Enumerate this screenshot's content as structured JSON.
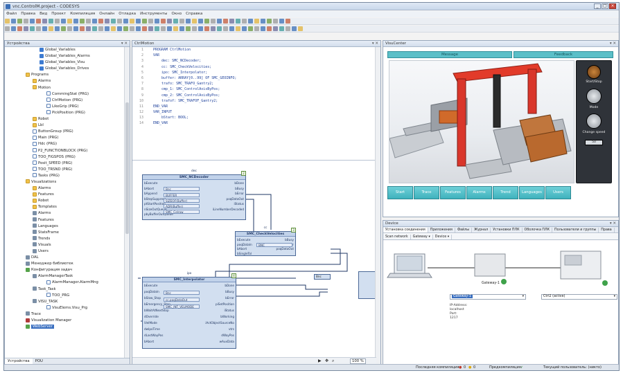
{
  "window": {
    "title": "vnc.ControlM.project - CODESYS",
    "min": "_",
    "max": "□",
    "close": "×"
  },
  "menu": [
    "Файл",
    "Правка",
    "Вид",
    "Проект",
    "Компиляция",
    "Онлайн",
    "Отладка",
    "Инструменты",
    "Окно",
    "Справка"
  ],
  "devices_panel": {
    "title": "Устройства",
    "header_btns": "▾ ✕",
    "tree": [
      {
        "indent": 5,
        "icon": "var",
        "label": "Global_Variables"
      },
      {
        "indent": 5,
        "icon": "var",
        "label": "Global_Variables_Alarms"
      },
      {
        "indent": 5,
        "icon": "var",
        "label": "Global_Variables_Visu"
      },
      {
        "indent": 5,
        "icon": "var",
        "label": "Global_Variables_Drives"
      },
      {
        "indent": 3,
        "icon": "folder",
        "label": "Programs"
      },
      {
        "indent": 4,
        "icon": "folder",
        "label": "Alarms"
      },
      {
        "indent": 4,
        "icon": "folder",
        "label": "Motion"
      },
      {
        "indent": 6,
        "icon": "prg",
        "label": "CommingStat (PRG)"
      },
      {
        "indent": 6,
        "icon": "prg",
        "label": "CtrlMotion (PRG)"
      },
      {
        "indent": 6,
        "icon": "prg",
        "label": "LikeGrip (PRG)"
      },
      {
        "indent": 6,
        "icon": "prg",
        "label": "PickPosition (PRG)"
      },
      {
        "indent": 4,
        "icon": "folder",
        "label": "Robot"
      },
      {
        "indent": 4,
        "icon": "folder",
        "label": "Lbl"
      },
      {
        "indent": 4,
        "icon": "prg",
        "label": "ButtonGroup (PRG)"
      },
      {
        "indent": 4,
        "icon": "prg",
        "label": "Main (PRG)"
      },
      {
        "indent": 4,
        "icon": "prg",
        "label": "Hdc (PRG)"
      },
      {
        "indent": 4,
        "icon": "prg",
        "label": "P2_FUNCTIONBLOCK (PRG)"
      },
      {
        "indent": 4,
        "icon": "prg",
        "label": "TOO_FIGSPOS (PRG)"
      },
      {
        "indent": 4,
        "icon": "prg",
        "label": "Posit_SPEED (PRG)"
      },
      {
        "indent": 4,
        "icon": "prg",
        "label": "TOO_TRSND (PRG)"
      },
      {
        "indent": 4,
        "icon": "prg",
        "label": "Tasks (PRG)"
      },
      {
        "indent": 3,
        "icon": "folder",
        "label": "Visualizations"
      },
      {
        "indent": 4,
        "icon": "folder",
        "label": "Alarms"
      },
      {
        "indent": 4,
        "icon": "folder",
        "label": "Features"
      },
      {
        "indent": 4,
        "icon": "folder",
        "label": "Robot"
      },
      {
        "indent": 4,
        "icon": "folder",
        "label": "Templates"
      },
      {
        "indent": 4,
        "icon": "cfg",
        "label": "Alarms"
      },
      {
        "indent": 4,
        "icon": "cfg",
        "label": "Features"
      },
      {
        "indent": 4,
        "icon": "cfg",
        "label": "Languages"
      },
      {
        "indent": 4,
        "icon": "cfg",
        "label": "StatsFrame"
      },
      {
        "indent": 4,
        "icon": "cfg",
        "label": "Trends"
      },
      {
        "indent": 4,
        "icon": "cfg",
        "label": "Visuals"
      },
      {
        "indent": 4,
        "icon": "cfg",
        "label": "Users"
      },
      {
        "indent": 3,
        "icon": "cfg",
        "label": "DAL"
      },
      {
        "indent": 3,
        "icon": "cfg",
        "label": "Менеджер библиотек"
      },
      {
        "indent": 3,
        "icon": "green",
        "label": "Конфигурация задач"
      },
      {
        "indent": 4,
        "icon": "cfg",
        "label": "AlarmManagerTask"
      },
      {
        "indent": 6,
        "icon": "prg",
        "label": "AlarmManager.AlarmMng"
      },
      {
        "indent": 4,
        "icon": "cfg",
        "label": "Task_Task"
      },
      {
        "indent": 6,
        "icon": "prg",
        "label": "TOO_PRG"
      },
      {
        "indent": 4,
        "icon": "cfg",
        "label": "VISU_TASK"
      },
      {
        "indent": 6,
        "icon": "prg",
        "label": "VisuElems.Visu_Prg"
      },
      {
        "indent": 3,
        "icon": "cfg",
        "label": "Trace"
      },
      {
        "indent": 3,
        "icon": "app",
        "label": "Visualization Manager"
      },
      {
        "indent": 3,
        "icon": "green",
        "label": "WebServer",
        "selected": true
      }
    ],
    "bottom_tabs": [
      "Устройства",
      "POU"
    ]
  },
  "editor": {
    "title": "CtrlMotion",
    "code": [
      {
        "ln": "1",
        "text": "PROGRAM CtrlMotion"
      },
      {
        "ln": "2",
        "text": "VAR"
      },
      {
        "ln": "3",
        "text": "    dec: SMC_NCDecoder;"
      },
      {
        "ln": "4",
        "text": "    cc: SMC_CheckVelocities;"
      },
      {
        "ln": "5",
        "text": "    ipo: SMC_Interpolator;"
      },
      {
        "ln": "6",
        "text": "    buffer: ARRAY[0..99] OF SMC_GEOINFO;"
      },
      {
        "ln": "7",
        "text": "    trafo: SMC_TRAFO_Gantry2;"
      },
      {
        "ln": "8",
        "text": "    cmp_1: SMC_ControlAxisByPos;"
      },
      {
        "ln": "9",
        "text": "    cmp_2: SMC_ControlAxisByPos;"
      },
      {
        "ln": "10",
        "text": "    trafof: SMC_TRAFOF_Gantry2;"
      },
      {
        "ln": "11",
        "text": "END_VAR"
      },
      {
        "ln": "12",
        "text": "VAR_INPUT"
      },
      {
        "ln": "13",
        "text": "    bStart: BOOL;"
      },
      {
        "ln": "14",
        "text": "END_VAR"
      }
    ],
    "zoom": "100 %",
    "fb_dec": {
      "instance": "dec",
      "name": "SMC_NCDecoder",
      "badge": "2",
      "inputs": [
        "bExecute",
        "bAbort",
        "bAppend",
        "bStepSuppress",
        "ptStartPosition",
        "nSizeOutQueue",
        "pbyBufferOutQueue"
      ],
      "boxes": [
        "Bnc",
        "BUFFER",
        "SIZEOF(Buffer)",
        "ADR(Buffer)",
        "SMC_Celrow"
      ],
      "outputs": [
        "bDone",
        "bBusy",
        "bError",
        "poqDataOut",
        "iStatus",
        "iLineNumberDecoded"
      ]
    },
    "fb_cc": {
      "instance": "cc",
      "name": "SMC_CheckVelocities",
      "badge": "3",
      "inputs": [
        "bExecute",
        "poqDataIn",
        "bAbort",
        "bSingleTol"
      ],
      "boxes": [
        "BNC"
      ],
      "outputs": [
        "bBusy",
        "bError",
        "poqDataOut"
      ]
    },
    "fb_ipo": {
      "instance": "ipo",
      "name": "SMC_Interpolator",
      "badge": "4",
      "inputs": [
        "bExecute",
        "poqDataIn",
        "bSlow_Stop",
        "bEmergency_Stop",
        "bWaitAtNextStop",
        "dOverride",
        "iVelMode",
        "dwIpoTime",
        "dLastWayPos",
        "bAbort"
      ],
      "boxes": [
        "Bnc",
        "cc.poqDataOut",
        "SMC_INT_VELMODE"
      ],
      "outputs": [
        "bDone",
        "bBusy",
        "bError",
        "piSetPosition",
        "iStatus",
        "bWorking",
        "iActObjectSourceNo",
        "vtrs",
        "dWayPos",
        "wAuxData"
      ]
    },
    "small_block": "Bnc"
  },
  "visu": {
    "title": "VisuCenter",
    "bar_left": "Message",
    "bar_right": "Feedback",
    "control_labels": [
      "Start/Stop",
      "Mode",
      "Change speed"
    ],
    "speed_value": "50",
    "nav_buttons": [
      "Start",
      "Trace",
      "Features",
      "Alarms",
      "Trend",
      "Languages",
      "Users"
    ]
  },
  "device": {
    "title": "Device",
    "tabs": [
      "Установка соединения",
      "Приложения",
      "Файлы",
      "Журнал",
      "Установки ПЛК",
      "Оболочка ПЛК",
      "Пользователи и группы",
      "Права"
    ],
    "subbar": [
      "Scan network",
      "Gateway ▾",
      "Device ▾"
    ],
    "gateway_name": "Gateway-1",
    "gateway_select": "Gateway-1",
    "device_select": "Ctrl2 (active)",
    "gateway_info": [
      "IP-Address:",
      "localhost",
      "Port:",
      "1217"
    ]
  },
  "status": {
    "last_compile": "Последняя компиляция:",
    "errors": "0",
    "warnings": "0",
    "precompile": "Предкомпиляция:",
    "user": "Текущий пользователь: (никто)"
  }
}
